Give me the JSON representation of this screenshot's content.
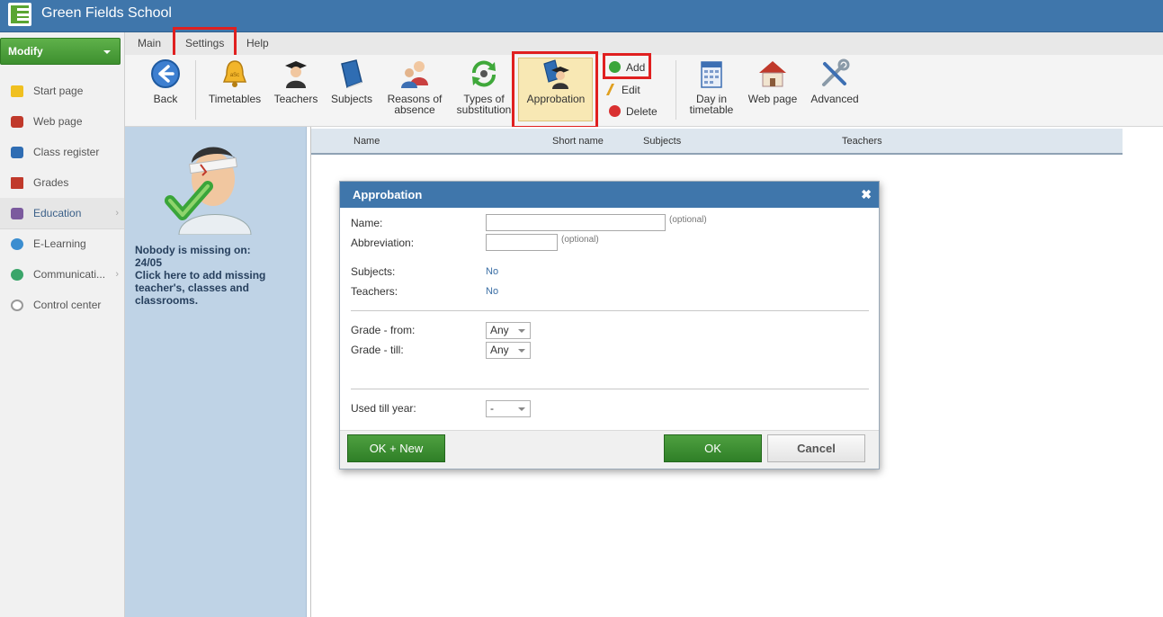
{
  "app": {
    "title": "Green Fields School"
  },
  "sidebar": {
    "modify_label": "Modify",
    "items": [
      {
        "label": "Start page",
        "icon": "star-icon"
      },
      {
        "label": "Web page",
        "icon": "house-icon"
      },
      {
        "label": "Class register",
        "icon": "book-icon"
      },
      {
        "label": "Grades",
        "icon": "grades-icon"
      },
      {
        "label": "Education",
        "icon": "education-icon"
      },
      {
        "label": "E-Learning",
        "icon": "globe-icon"
      },
      {
        "label": "Communicati...",
        "icon": "communication-icon"
      },
      {
        "label": "Control center",
        "icon": "gear-icon"
      }
    ]
  },
  "menu": {
    "tabs": [
      "Main",
      "Settings",
      "Help"
    ]
  },
  "toolbar": {
    "back": "Back",
    "timetables": "Timetables",
    "teachers": "Teachers",
    "subjects": "Subjects",
    "reasons_1": "Reasons of",
    "reasons_2": "absence",
    "types_1": "Types of",
    "types_2": "substitution",
    "approbation": "Approbation",
    "add": "Add",
    "edit": "Edit",
    "delete": "Delete",
    "day_1": "Day in",
    "day_2": "timetable",
    "web_page": "Web page",
    "advanced": "Advanced"
  },
  "info": {
    "line1": "Nobody is missing on:",
    "line2": "24/05",
    "line3": "Click here to add missing",
    "line4": "teacher's, classes and",
    "line5": "classrooms."
  },
  "table": {
    "columns": [
      "Name",
      "Short name",
      "Subjects",
      "Teachers"
    ]
  },
  "dialog": {
    "title": "Approbation",
    "name_label": "Name:",
    "name_value": "",
    "optional": "(optional)",
    "abbreviation_label": "Abbreviation:",
    "abbreviation_value": "",
    "subjects_label": "Subjects:",
    "subjects_value": "No",
    "teachers_label": "Teachers:",
    "teachers_value": "No",
    "grade_from_label": "Grade - from:",
    "grade_from_value": "Any",
    "grade_till_label": "Grade - till:",
    "grade_till_value": "Any",
    "used_till_label": "Used till year:",
    "used_till_value": "-",
    "ok_new": "OK + New",
    "ok": "OK",
    "cancel": "Cancel"
  },
  "colors": {
    "brand_blue": "#3f76ab",
    "green": "#3d8f2f",
    "highlight_red": "#e02020"
  }
}
